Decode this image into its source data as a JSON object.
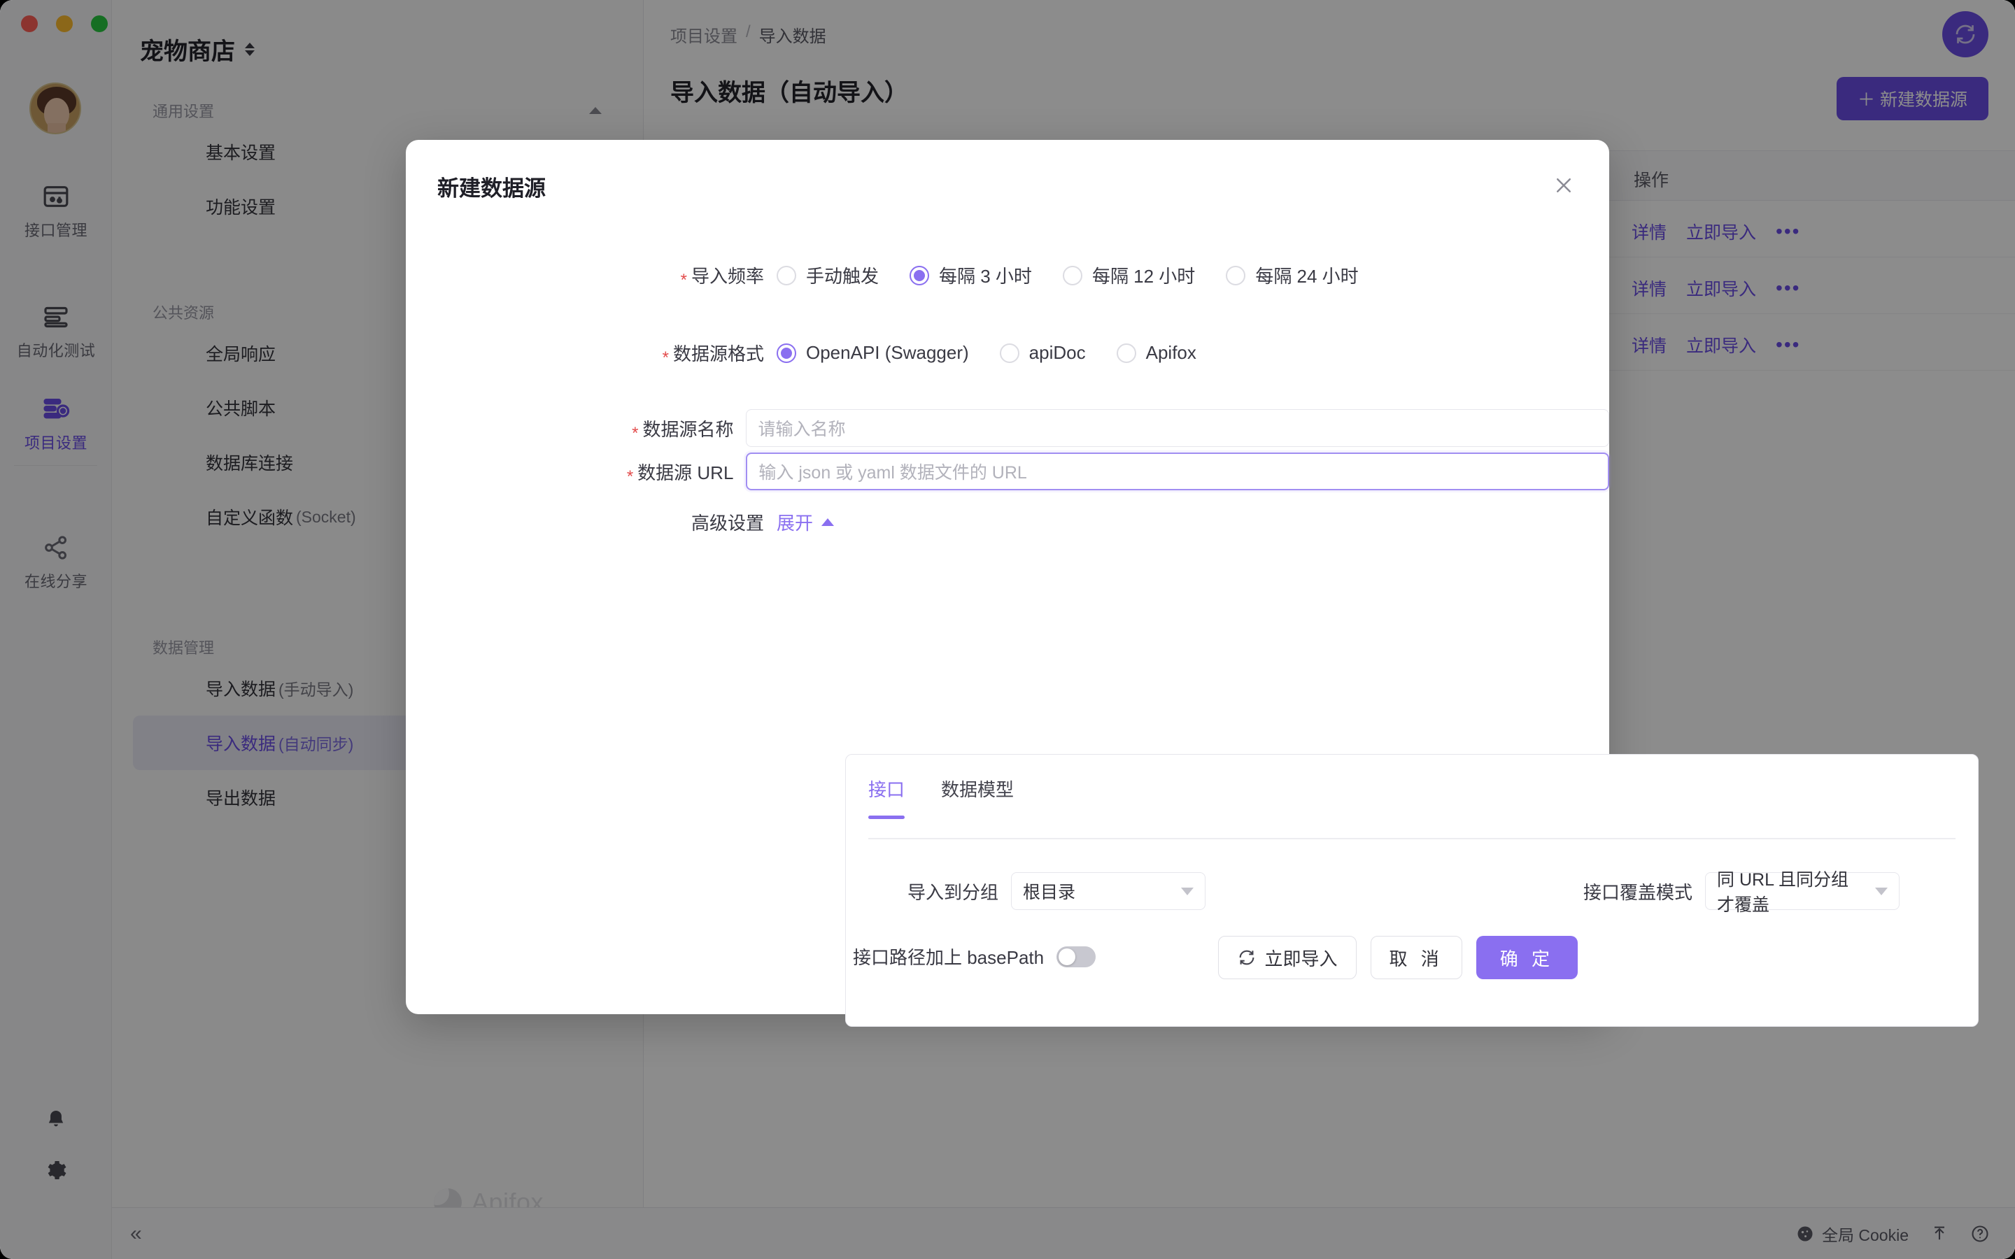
{
  "window": {
    "traffic_lights": [
      "close",
      "minimize",
      "zoom"
    ]
  },
  "rail": {
    "items": [
      {
        "label": "接口管理",
        "icon": "api-management-icon",
        "active": false
      },
      {
        "label": "自动化测试",
        "icon": "automation-test-icon",
        "active": false
      },
      {
        "label": "项目设置",
        "icon": "project-settings-icon",
        "active": true
      },
      {
        "label": "在线分享",
        "icon": "share-icon",
        "active": false
      }
    ],
    "bottom_icons": [
      {
        "name": "bell-icon"
      },
      {
        "name": "gear-icon"
      }
    ]
  },
  "subnav": {
    "project_name": "宠物商店",
    "groups": [
      {
        "title": "通用设置",
        "collapsible": true,
        "items": [
          {
            "label": "基本设置",
            "sub": "",
            "selected": false
          },
          {
            "label": "功能设置",
            "sub": "",
            "selected": false
          }
        ]
      },
      {
        "title": "公共资源",
        "collapsible": false,
        "items": [
          {
            "label": "全局响应",
            "sub": "",
            "selected": false
          },
          {
            "label": "公共脚本",
            "sub": "",
            "selected": false
          },
          {
            "label": "数据库连接",
            "sub": "",
            "selected": false
          },
          {
            "label": "自定义函数",
            "sub": "(Socket)",
            "selected": false
          }
        ]
      },
      {
        "title": "数据管理",
        "collapsible": false,
        "items": [
          {
            "label": "导入数据",
            "sub": "(手动导入)",
            "selected": false
          },
          {
            "label": "导入数据",
            "sub": "(自动同步)",
            "selected": true
          },
          {
            "label": "导出数据",
            "sub": "",
            "selected": false
          }
        ]
      }
    ],
    "watermark": "Apifox"
  },
  "main": {
    "breadcrumb": [
      "项目设置",
      "导入数据"
    ],
    "breadcrumb_separator": "/",
    "page_title": "导入数据（自动导入）",
    "new_datasource_button": "＋ 新建数据源",
    "sync_fab_icon": "sync-icon",
    "table": {
      "action_column_header": "操作",
      "rows": [
        {
          "detail": "详情",
          "import_now": "立即导入",
          "more": "•••"
        },
        {
          "detail": "详情",
          "import_now": "立即导入",
          "more": "•••"
        },
        {
          "detail": "详情",
          "import_now": "立即导入",
          "more": "•••"
        }
      ]
    }
  },
  "statusbar": {
    "collapse_icon": "«",
    "cookie_label": "全局 Cookie",
    "cookie_icon": "cookie-icon",
    "upgrade_icon": "upgrade-icon",
    "help_icon": "help-icon"
  },
  "modal": {
    "title": "新建数据源",
    "close_icon": "close-icon",
    "fields": {
      "frequency": {
        "label": "导入频率",
        "required": true,
        "options": [
          {
            "label": "手动触发",
            "checked": false
          },
          {
            "label": "每隔 3 小时",
            "checked": true
          },
          {
            "label": "每隔 12 小时",
            "checked": false
          },
          {
            "label": "每隔 24 小时",
            "checked": false
          }
        ]
      },
      "format": {
        "label": "数据源格式",
        "required": true,
        "options": [
          {
            "label": "OpenAPI (Swagger)",
            "checked": true
          },
          {
            "label": "apiDoc",
            "checked": false
          },
          {
            "label": "Apifox",
            "checked": false
          }
        ]
      },
      "name": {
        "label": "数据源名称",
        "required": true,
        "value": "",
        "placeholder": "请输入名称"
      },
      "url": {
        "label": "数据源 URL",
        "required": true,
        "value": "",
        "placeholder": "输入 json 或 yaml 数据文件的 URL",
        "focused": true
      },
      "advanced": {
        "label": "高级设置",
        "toggle_label": "展开",
        "expanded": true
      }
    },
    "advanced_panel": {
      "tabs": [
        {
          "label": "接口",
          "active": true
        },
        {
          "label": "数据模型",
          "active": false
        }
      ],
      "import_group": {
        "label": "导入到分组",
        "value": "根目录",
        "options": [
          "根目录"
        ]
      },
      "overwrite_mode": {
        "label": "接口覆盖模式",
        "value": "同 URL 且同分组才覆盖",
        "options": [
          "同 URL 且同分组才覆盖"
        ]
      },
      "base_path": {
        "label": "接口路径加上 basePath",
        "enabled": false
      }
    },
    "footer": {
      "import_now": "立即导入",
      "import_now_icon": "refresh-icon",
      "cancel": "取 消",
      "confirm": "确 定"
    }
  },
  "colors": {
    "accent": "#6b4ee6",
    "accent_light": "#8a6ff0",
    "required_star": "#e34c4c",
    "text_primary": "#24242b",
    "text_muted": "#8c8c96"
  }
}
